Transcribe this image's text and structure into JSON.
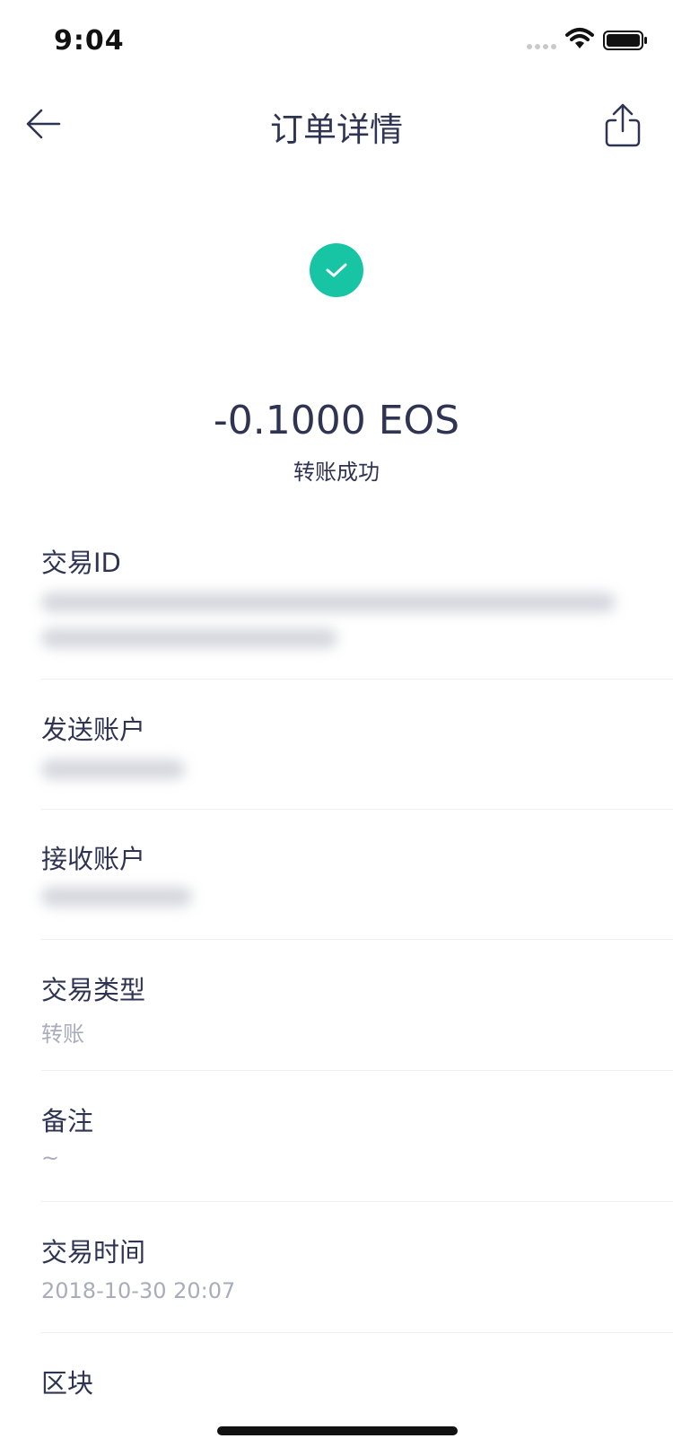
{
  "status_bar": {
    "time": "9:04"
  },
  "header": {
    "title": "订单详情"
  },
  "transaction": {
    "amount": "-0.1000 EOS",
    "status": "转账成功",
    "accent_color": "#17c4a4"
  },
  "details": {
    "tx_id": {
      "label": "交易ID"
    },
    "sender": {
      "label": "发送账户"
    },
    "receiver": {
      "label": "接收账户"
    },
    "type": {
      "label": "交易类型",
      "value": "转账"
    },
    "memo": {
      "label": "备注",
      "value": "~"
    },
    "time": {
      "label": "交易时间",
      "value": "2018-10-30 20:07"
    },
    "block": {
      "label": "区块"
    }
  },
  "icons": {
    "back": "arrow-left",
    "share": "share-upload",
    "success": "check-circle"
  }
}
